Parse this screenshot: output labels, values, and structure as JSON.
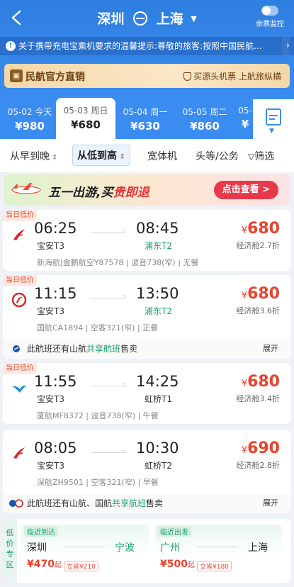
{
  "header": {
    "from_city": "深圳",
    "to_city": "上海",
    "monitor_label": "余票监控",
    "notice": "关于携带充电宝乘机要求的温馨提示:尊敬的旅客:按照中国民航...",
    "official_title": "民航官方直销",
    "official_sub": "买源头机票 上航旅纵横",
    "colors": {
      "primary": "#3a8cf0",
      "price": "#e8432e",
      "green": "#1ba06c"
    }
  },
  "dates": [
    {
      "date": "05-02 今天",
      "price": "¥980"
    },
    {
      "date": "05-03 周日",
      "price": "¥680",
      "active": true
    },
    {
      "date": "05-04 周一",
      "price": "¥630"
    },
    {
      "date": "05-05 周二",
      "price": "¥860"
    },
    {
      "date": "05-",
      "price": "¥"
    }
  ],
  "sort": {
    "time": "从早到晚",
    "price": "从低到高",
    "wide": "宽体机",
    "class": "头等/公务",
    "filter": "筛选"
  },
  "promo": {
    "text_a": "五一出游,买",
    "text_b": "贵",
    "text_c": "即退",
    "button": "点击查看 >"
  },
  "flights": [
    {
      "tag": "当日低价",
      "logo": "shenzhen-airlines-logo",
      "dep_time": "06:25",
      "arr_time": "08:45",
      "dep_airport": "宝安T3",
      "arr_airport": "浦东T2",
      "info": "新海航|金鹏航空Y87578 | 波音738(窄) | 无餐",
      "price": "680",
      "cabin": "经济舱2.7折"
    },
    {
      "tag": "当日低价",
      "logo": "air-china-logo",
      "dep_time": "11:15",
      "arr_time": "13:50",
      "dep_airport": "宝安T3",
      "arr_airport": "浦东T2",
      "info": "国航CA1894 | 空客321(窄) | 正餐",
      "price": "680",
      "cabin": "经济舱3.6折",
      "shared_a": "此航班还有山航",
      "shared_b": "共享航班",
      "shared_c": "售卖",
      "expand": "展开"
    },
    {
      "tag": "当日低价",
      "logo": "xiamen-airlines-logo",
      "dep_time": "11:55",
      "arr_time": "14:25",
      "dep_airport": "宝安T3",
      "arr_airport": "虹桥T1",
      "info": "厦航MF8372 | 波音738(窄) | 午餐",
      "price": "680",
      "cabin": "经济舱3.4折"
    },
    {
      "logo": "shenzhen-airlines-logo",
      "dep_time": "08:05",
      "arr_time": "10:30",
      "dep_airport": "宝安T3",
      "arr_airport": "虹桥T2",
      "info": "深航ZH9501 | 空客321(窄) | 早餐",
      "price": "690",
      "cabin": "经济舱2.8折",
      "shared_a": "此航班还有山航、国航",
      "shared_b": "共享航班",
      "shared_c": "售卖",
      "expand": "展开"
    }
  ],
  "lowprice": {
    "label": "低价专区",
    "cards": [
      {
        "tag": "临近到达",
        "from": "深圳",
        "to": "宁波",
        "price": "¥470",
        "suffix": "起",
        "save": "立省¥210"
      },
      {
        "tag": "临近出发",
        "from": "广州",
        "to": "上海",
        "price": "¥500",
        "suffix": "起",
        "save": "立省¥180"
      }
    ]
  }
}
